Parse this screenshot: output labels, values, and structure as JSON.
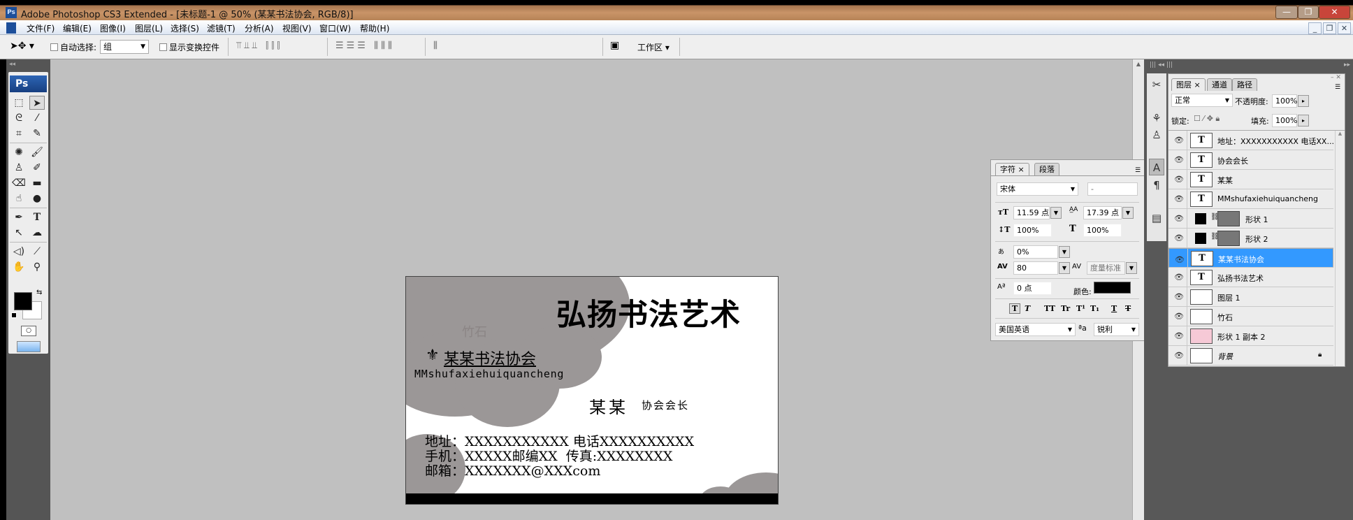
{
  "window": {
    "title": "Adobe Photoshop CS3 Extended - [未标题-1 @ 50% (某某书法协会, RGB/8)]",
    "app_icon": "Ps"
  },
  "menu": [
    "文件(F)",
    "编辑(E)",
    "图像(I)",
    "图层(L)",
    "选择(S)",
    "滤镜(T)",
    "分析(A)",
    "视图(V)",
    "窗口(W)",
    "帮助(H)"
  ],
  "options": {
    "auto_select_label": "自动选择:",
    "auto_select_value": "组",
    "show_transform_label": "显示变换控件",
    "workspace_label": "工作区 ▾"
  },
  "toolbox": {
    "logo": "Ps"
  },
  "character_panel": {
    "tabs": [
      "字符",
      "段落"
    ],
    "font_family": "宋体",
    "font_style": "-",
    "font_size": "11.59 点",
    "leading": "17.39 点",
    "vertical_scale": "100%",
    "horizontal_scale": "100%",
    "tsume": "0%",
    "tracking": "80",
    "kerning": "度量标准",
    "baseline_shift": "0 点",
    "color_label": "颜色:",
    "color": "#000000",
    "style_buttons": [
      "T",
      "T",
      "TT",
      "Tr",
      "T¹",
      "T₁",
      "T",
      "T"
    ],
    "language": "美国英语",
    "aa_label": "ªa",
    "antialias": "锐利"
  },
  "layers_panel": {
    "tabs": [
      "图层",
      "通道",
      "路径"
    ],
    "blend_mode": "正常",
    "opacity_label": "不透明度:",
    "opacity": "100%",
    "lock_label": "锁定:",
    "fill_label": "填充:",
    "fill": "100%",
    "layers": [
      {
        "name": "地址：XXXXXXXXXXX 电话XX...",
        "type": "text"
      },
      {
        "name": "协会会长",
        "type": "text"
      },
      {
        "name": "某某",
        "type": "text"
      },
      {
        "name": "MMshufaxiehuiquancheng",
        "type": "text"
      },
      {
        "name": "形状 1",
        "type": "shape"
      },
      {
        "name": "形状 2",
        "type": "shape"
      },
      {
        "name": "某某书法协会",
        "type": "text",
        "selected": true
      },
      {
        "name": "弘扬书法艺术",
        "type": "text"
      },
      {
        "name": "图层 1",
        "type": "raster"
      },
      {
        "name": "竹石",
        "type": "raster"
      },
      {
        "name": "形状 1 副本 2",
        "type": "raster"
      },
      {
        "name": "背景",
        "type": "background",
        "locked": true
      }
    ]
  },
  "card": {
    "title": "弘扬书法艺术",
    "org": "某某书法协会",
    "org_pinyin": "MMshufaxiehuiquancheng",
    "person": "某某",
    "role": "协会会长",
    "faint": "竹石",
    "line1": "地址：XXXXXXXXXXX 电话XXXXXXXXXX",
    "line2": "手机：XXXXX邮编XX  传真:XXXXXXXX",
    "line3": "邮箱：XXXXXXX@XXXcom"
  }
}
